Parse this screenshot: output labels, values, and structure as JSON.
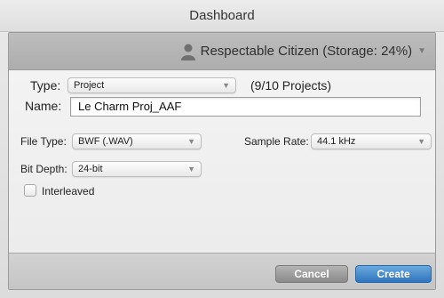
{
  "window": {
    "title": "Dashboard"
  },
  "user": {
    "label": "Respectable Citizen (Storage: 24%)",
    "icon": "person-icon",
    "storage_percent": 24
  },
  "form": {
    "type_label": "Type:",
    "type_value": "Project",
    "project_count": "(9/10 Projects)",
    "name_label": "Name:",
    "name_value": "Le Charm Proj_AAF",
    "file_type_label": "File Type:",
    "file_type_value": "BWF (.WAV)",
    "sample_rate_label": "Sample Rate:",
    "sample_rate_value": "44.1 kHz",
    "bit_depth_label": "Bit Depth:",
    "bit_depth_value": "24-bit",
    "interleaved_label": "Interleaved",
    "interleaved_checked": false
  },
  "buttons": {
    "cancel": "Cancel",
    "create": "Create"
  },
  "colors": {
    "create_button": "#3a7fc4",
    "userbar": "#b3b3b3"
  }
}
